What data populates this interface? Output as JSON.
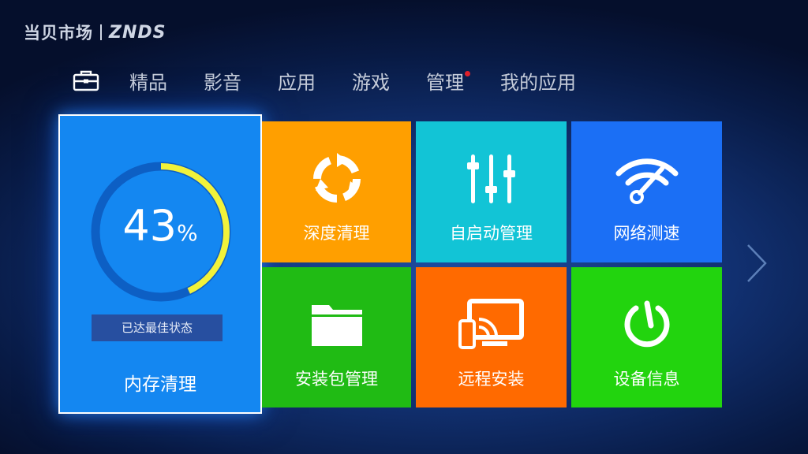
{
  "brand": {
    "name_cn": "当贝市场",
    "name_en": "ZNDS"
  },
  "nav": {
    "home_icon": "toolbox-icon",
    "items": [
      "精品",
      "影音",
      "应用",
      "游戏",
      "管理",
      "我的应用"
    ],
    "notification_on": "管理"
  },
  "memory": {
    "percent": "43",
    "percent_sign": "%",
    "usage_fraction": 0.43,
    "status": "已达最佳状态",
    "label": "内存清理"
  },
  "tiles": [
    {
      "label": "深度清理",
      "icon": "recycle-icon",
      "color": "#ff9f00"
    },
    {
      "label": "自启动管理",
      "icon": "sliders-icon",
      "color": "#12c4d6"
    },
    {
      "label": "网络测速",
      "icon": "wifi-speed-icon",
      "color": "#1b6ff5"
    },
    {
      "label": "安装包管理",
      "icon": "folder-icon",
      "color": "#20bb14"
    },
    {
      "label": "远程安装",
      "icon": "cast-icon",
      "color": "#ff6a00"
    },
    {
      "label": "设备信息",
      "icon": "power-icon",
      "color": "#22d40e"
    }
  ],
  "colors": {
    "selected_tile": "#1487f1",
    "gauge_track": "#0d5fc4",
    "gauge_progress": "#f2f23a",
    "notification_dot": "#e0202a"
  },
  "navigation": {
    "next_icon": "chevron-right-icon"
  }
}
